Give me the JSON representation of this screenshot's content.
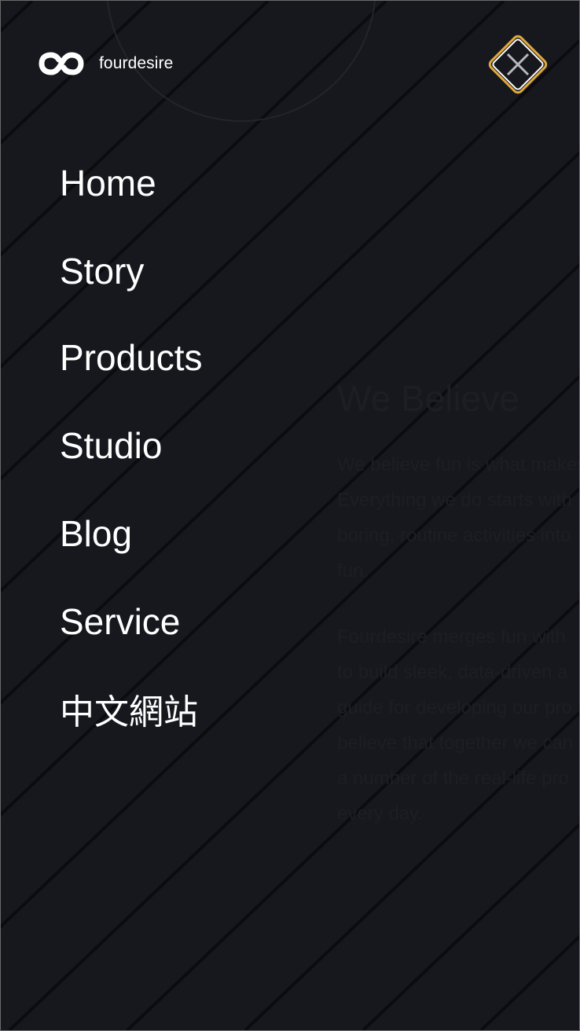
{
  "brand": {
    "name": "fourdesire",
    "icon": "infinity-logo-icon"
  },
  "close_button": {
    "icon": "close-x-icon",
    "accent_color": "#e0a93b"
  },
  "menu": {
    "items": [
      {
        "label": "Home"
      },
      {
        "label": "Story"
      },
      {
        "label": "Products"
      },
      {
        "label": "Studio"
      },
      {
        "label": "Blog"
      },
      {
        "label": "Service"
      },
      {
        "label": "中文網站"
      }
    ]
  },
  "background_section": {
    "title": "We Believe",
    "paragraphs": [
      {
        "lines": [
          "We believe fun is what makes",
          "Everything we do starts with",
          "boring, routine activities into",
          "fun."
        ]
      },
      {
        "lines": [
          "Fourdesire merges fun with",
          "to build sleek, data-driven a",
          "guide for developing our pro",
          "believe that together we can",
          "a number of the real-life pro",
          "every day."
        ]
      }
    ]
  },
  "theme": {
    "background": "#17181e",
    "stripe": "#0b0c10",
    "text": "#ffffff"
  }
}
